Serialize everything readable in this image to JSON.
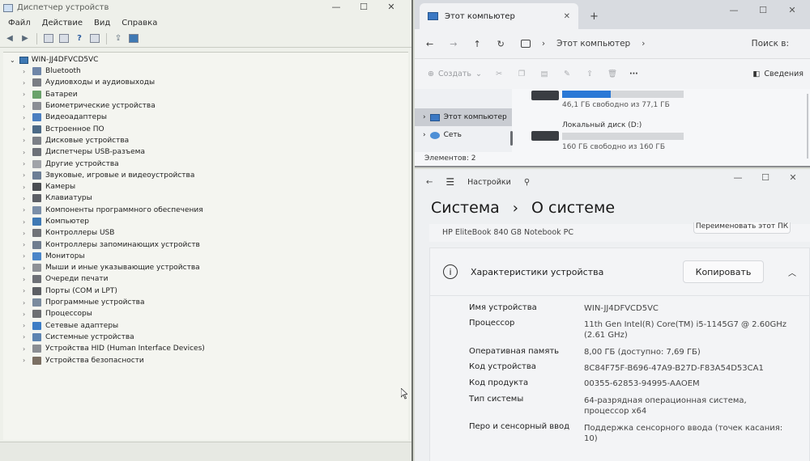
{
  "device_manager": {
    "title": "Диспетчер устройств",
    "menu": [
      "Файл",
      "Действие",
      "Вид",
      "Справка"
    ],
    "computer_name": "WIN-JJ4DFVCD5VC",
    "categories": [
      "Bluetooth",
      "Аудиовходы и аудиовыходы",
      "Батареи",
      "Биометрические устройства",
      "Видеоадаптеры",
      "Встроенное ПО",
      "Дисковые устройства",
      "Диспетчеры USB-разъема",
      "Другие устройства",
      "Звуковые, игровые и видеоустройства",
      "Камеры",
      "Клавиатуры",
      "Компоненты программного обеспечения",
      "Компьютер",
      "Контроллеры USB",
      "Контроллеры запоминающих устройств",
      "Мониторы",
      "Мыши и иные указывающие устройства",
      "Очереди печати",
      "Порты (COM и LPT)",
      "Программные устройства",
      "Процессоры",
      "Сетевые адаптеры",
      "Системные устройства",
      "Устройства HID (Human Interface Devices)",
      "Устройства безопасности"
    ],
    "icon_colors": [
      "#6f86a8",
      "#7a7d84",
      "#6aa26b",
      "#8b8e94",
      "#4b7fc0",
      "#4c6a86",
      "#7c8087",
      "#6d7178",
      "#a0a3a8",
      "#6c7e95",
      "#4a4d52",
      "#5d6066",
      "#7b8fa8",
      "#3f79b4",
      "#707378",
      "#6f7d8f",
      "#4b86c8",
      "#8e9196",
      "#6d7076",
      "#5c5f64",
      "#7a8b9e",
      "#6d6f73",
      "#3d7dc5",
      "#5e84b0",
      "#8b8e93",
      "#7b6f63"
    ]
  },
  "explorer": {
    "tab_title": "Этот компьютер",
    "breadcrumb": "Этот компьютер",
    "search_placeholder": "Поиск в:",
    "create_label": "Создать",
    "details_label": "Сведения",
    "nav": {
      "this_pc": "Этот компьютер",
      "network": "Сеть"
    },
    "drive_c": {
      "free_text": "46,1 ГБ свободно из 77,1 ГБ",
      "used_fraction": 0.4
    },
    "drive_d": {
      "label": "Локальный диск (D:)",
      "free_text": "160 ГБ свободно из 160 ГБ",
      "used_fraction": 0.0
    },
    "status": "Элементов: 2",
    "accent_color": "#2a78d6"
  },
  "settings": {
    "app_label": "Настройки",
    "breadcrumb_parent": "Система",
    "breadcrumb_current": "О системе",
    "model": "HP EliteBook 840 G8 Notebook PC",
    "rename_label": "Переименовать этот ПК",
    "spec_title": "Характеристики устройства",
    "copy_label": "Копировать",
    "specs": [
      {
        "label": "Имя устройства",
        "value": "WIN-JJ4DFVCD5VC"
      },
      {
        "label": "Процессор",
        "value": "11th Gen Intel(R) Core(TM) i5-1145G7 @ 2.60GHz (2.61 GHz)"
      },
      {
        "label": "Оперативная память",
        "value": "8,00 ГБ (доступно: 7,69 ГБ)"
      },
      {
        "label": "Код устройства",
        "value": "8C84F75F-B696-47A9-B27D-F83A54D53CA1"
      },
      {
        "label": "Код продукта",
        "value": "00355-62853-94995-AAOEM"
      },
      {
        "label": "Тип системы",
        "value": "64-разрядная операционная система, процессор x64"
      },
      {
        "label": "Перо и сенсорный ввод",
        "value": "Поддержка сенсорного ввода (точек касания: 10)"
      }
    ]
  }
}
